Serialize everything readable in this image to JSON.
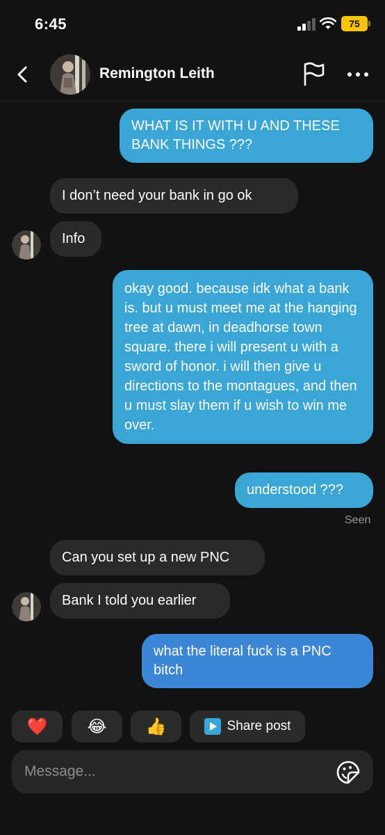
{
  "status": {
    "time": "6:45",
    "battery": "75"
  },
  "header": {
    "contact_name": "Remington Leith"
  },
  "messages": [
    {
      "side": "out",
      "text": "WHAT IS IT WITH U AND THESE BANK THINGS ???"
    },
    {
      "side": "in",
      "text": "I don’t need your bank in go ok"
    },
    {
      "side": "in",
      "text": "Info"
    },
    {
      "side": "out",
      "text": "okay good. because idk what a bank is. but u must meet me at the hanging tree at dawn, in deadhorse town square. there i will present u with a sword of honor. i will then give u directions to the montagues, and then u must slay them if u wish to win me over."
    },
    {
      "side": "out",
      "text": "understood ???"
    },
    {
      "side": "in",
      "text": "Can you set up a new PNC"
    },
    {
      "side": "in",
      "text": "Bank I told you earlier"
    },
    {
      "side": "out",
      "text": "what the literal fuck is a PNC bitch"
    }
  ],
  "seen_label": "Seen",
  "quick_reactions": [
    "❤️",
    "😂",
    "👍"
  ],
  "share_post_label": "Share post",
  "composer": {
    "placeholder": "Message..."
  },
  "colors": {
    "outgoing_bubble": "#3aa6d6",
    "incoming_bubble": "#2a2a2a",
    "background": "#121212"
  }
}
